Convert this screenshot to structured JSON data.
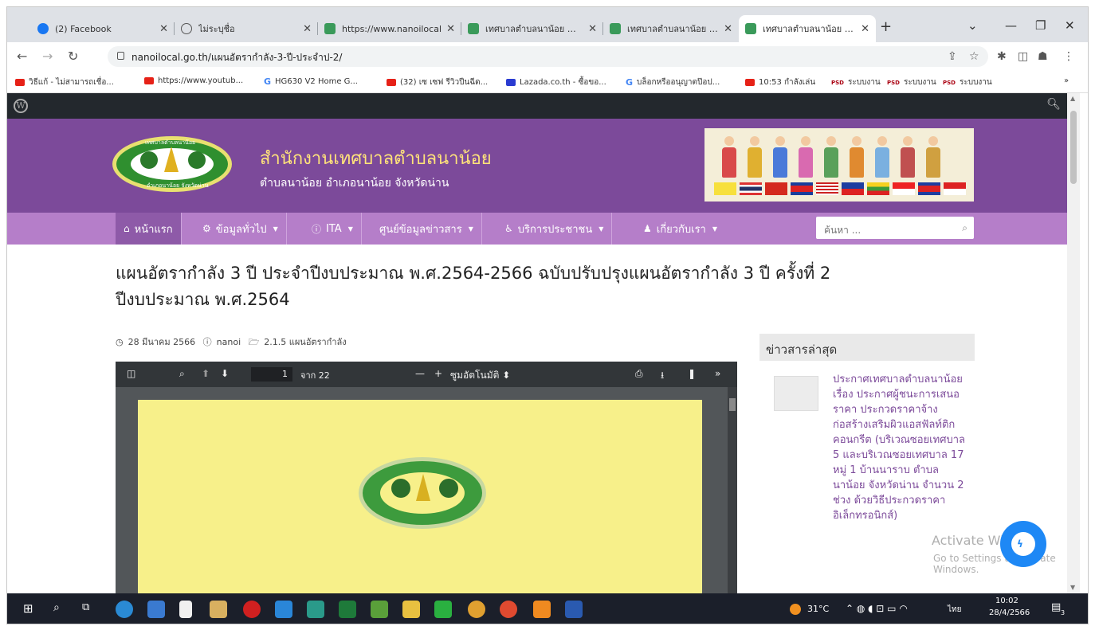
{
  "browser": {
    "tabs": [
      {
        "title": "(2) Facebook",
        "icon": "facebook-icon",
        "active": false
      },
      {
        "title": "ไม่ระบุชื่อ",
        "icon": "globe-icon",
        "active": false
      },
      {
        "title": "https://www.nanoilocal",
        "icon": "site-icon",
        "active": false
      },
      {
        "title": "เทศบาลตำบลนาน้อย อำเภ",
        "icon": "site-icon",
        "active": false
      },
      {
        "title": "เทศบาลตำบลนาน้อย อำเภ",
        "icon": "site-icon",
        "active": false
      },
      {
        "title": "เทศบาลตำบลนาน้อย อำเภ",
        "icon": "site-icon",
        "active": true
      }
    ],
    "url": "nanoilocal.go.th/แผนอัตรากำลัง-3-ปี-ประจำป-2/",
    "bookmarks": [
      {
        "label": "วิธีแก้ - ไม่สามารถเชื่อ...",
        "icon": "youtube-icon"
      },
      {
        "label": "https://www.youtub...",
        "icon": "youtube-icon"
      },
      {
        "label": "HG630 V2 Home G...",
        "icon": "google-icon"
      },
      {
        "label": "(32) เซ เซฟ รีวิวปืนฉีด...",
        "icon": "youtube-icon"
      },
      {
        "label": "Lazada.co.th - ซื้อขอ...",
        "icon": "lazada-icon"
      },
      {
        "label": "บล็อกหรืออนุญาตป๊อป...",
        "icon": "google-icon"
      },
      {
        "label": "10:53 กำลังเล่น",
        "icon": "youtube-icon"
      },
      {
        "label": "ระบบงาน",
        "icon": "psd-icon"
      },
      {
        "label": "ระบบงาน",
        "icon": "psd-icon"
      },
      {
        "label": "ระบบงาน",
        "icon": "psd-icon"
      }
    ],
    "more_bookmarks": "»"
  },
  "site": {
    "title": "สำนักงานเทศบาลตำบลนาน้อย",
    "subtitle": "ตำบลนาน้อย อำเภอนาน้อย จังหวัดน่าน",
    "logo_text_top": "เทศบาลตำบลนาน้อย",
    "logo_text_bottom": "อำเภอนาน้อย จังหวัดน่าน",
    "colors": {
      "header": "#7c4a9a",
      "nav": "#b57ec9",
      "title": "#ffe37a",
      "link": "#7c4a9a"
    }
  },
  "nav": {
    "items": [
      {
        "label": "หน้าแรก",
        "icon": "home-icon",
        "dropdown": false
      },
      {
        "label": "ข้อมูลทั่วไป",
        "icon": "gear-icon",
        "dropdown": true
      },
      {
        "label": "ITA",
        "icon": "info-icon",
        "dropdown": true
      },
      {
        "label": "ศูนย์ข้อมูลข่าวสาร",
        "icon": "",
        "dropdown": true
      },
      {
        "label": "บริการประชาชน",
        "icon": "accessibility-icon",
        "dropdown": true
      },
      {
        "label": "เกี่ยวกับเรา",
        "icon": "user-icon",
        "dropdown": true
      }
    ],
    "search_placeholder": "ค้นหา ..."
  },
  "post": {
    "title_line1": "แผนอัตรากำลัง 3 ปี ประจำปีงบประมาณ พ.ศ.2564-2566 ฉบับปรับปรุงแผนอัตรากำลัง 3 ปี ครั้งที่ 2",
    "title_line2": "ปีงบประมาณ พ.ศ.2564",
    "date": "28 มีนาคม 2566",
    "author": "nanoi",
    "category": "2.1.5 แผนอัตรากำลัง"
  },
  "pdf": {
    "page": "1",
    "of_pages": "จาก 22",
    "zoom": "ซูมอัตโนมัติ",
    "page_number": 1,
    "page_count": 22
  },
  "sidebar": {
    "heading": "ข่าวสารล่าสุด",
    "news": "ประกาศเทศบาลตำบลนาน้อย เรื่อง ประกาศผู้ชนะการเสนอราคา ประกวดราคาจ้างก่อสร้างเสริมผิวแอสฟัลท์ติกคอนกรีต (บริเวณซอยเทศบาล 5 และบริเวณซอยเทศบาล 17 หมู่ 1 บ้านนาราบ ตำบลนาน้อย จังหวัดน่าน จำนวน 2 ช่วง ด้วยวิธีประกวดราคาอิเล็กทรอนิกส์)"
  },
  "watermark": {
    "line1": "Activate Windows",
    "line2": "Go to Settings to activate Windows."
  },
  "taskbar": {
    "temperature": "31°C",
    "lang": "ไทย",
    "time": "10:02",
    "date": "28/4/2566",
    "notifications": "3"
  }
}
